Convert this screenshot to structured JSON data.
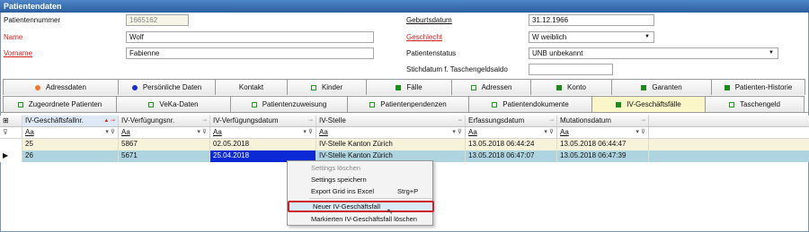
{
  "window": {
    "title": "Patientendaten"
  },
  "form": {
    "patientennummer": {
      "label": "Patientennummer",
      "value": "1665162"
    },
    "name": {
      "label": "Name",
      "value": "Wolf"
    },
    "vorname": {
      "label": "Vorname",
      "value": "Fabienne"
    },
    "geburtsdatum": {
      "label": "Geburtsdatum",
      "value": "31.12.1966"
    },
    "geschlecht": {
      "label": "Geschlecht",
      "value": "W weiblich"
    },
    "patientenstatus": {
      "label": "Patientenstatus",
      "value": "UNB unbekannt"
    },
    "stichdatum": {
      "label": "Stichdatum f. Taschengeldsaldo",
      "value": ""
    }
  },
  "tabs_row1": [
    {
      "label": "Adressdaten",
      "icon": "orange-dot-icon",
      "color": "#f07a2a"
    },
    {
      "label": "Persönliche Daten",
      "icon": "blue-dot-icon",
      "color": "#1530d8"
    },
    {
      "label": "Kontakt",
      "icon": "",
      "color": ""
    },
    {
      "label": "Kinder",
      "icon": "green-square-outline-icon",
      "color": "#1f9a1f"
    },
    {
      "label": "Fälle",
      "icon": "green-square-filled-icon",
      "color": "#1a8c1a"
    },
    {
      "label": "Adressen",
      "icon": "green-square-outline-icon",
      "color": "#1f9a1f"
    },
    {
      "label": "Konto",
      "icon": "green-square-filled-icon",
      "color": "#1a8c1a"
    },
    {
      "label": "Garanten",
      "icon": "green-square-filled-icon",
      "color": "#1a8c1a"
    },
    {
      "label": "Patienten-Historie",
      "icon": "green-square-filled-icon",
      "color": "#1a8c1a"
    }
  ],
  "tabs_row2": [
    {
      "label": "Zugeordnete Patienten",
      "icon": "green-square-outline-icon"
    },
    {
      "label": "VeKa-Daten",
      "icon": "green-square-outline-icon"
    },
    {
      "label": "Patientenzuweisung",
      "icon": "green-square-outline-icon"
    },
    {
      "label": "Patientenpendenzen",
      "icon": "green-square-outline-icon"
    },
    {
      "label": "Patientendokumente",
      "icon": "green-square-outline-icon"
    },
    {
      "label": "IV-Geschäftsfälle",
      "icon": "green-square-filled-icon",
      "active": true
    },
    {
      "label": "Taschengeld",
      "icon": "green-square-outline-icon"
    }
  ],
  "grid": {
    "columns": [
      "IV-Geschäftsfallnr.",
      "IV-Verfügungsnr.",
      "IV-Verfügungsdatum",
      "IV-Stelle",
      "Erfassungsdatum",
      "Mutationsdatum"
    ],
    "filter_placeholder": "Aa",
    "rows": [
      [
        "25",
        "5867",
        "02.05.2018",
        "IV-Stelle Kanton Zürich",
        "13.05.2018 06:44:24",
        "13.05.2018 06:44:47"
      ],
      [
        "26",
        "5671",
        "25.04.2018",
        "IV-Stelle Kanton Zürich",
        "13.05.2018 06:47:07",
        "13.05.2018 06:47:39"
      ]
    ]
  },
  "context_menu": {
    "items": [
      {
        "label": "Settings löschen",
        "disabled": true
      },
      {
        "label": "Settings speichern"
      },
      {
        "label": "Export Grid ins Excel",
        "shortcut": "Strg+P"
      },
      {
        "label": "Neuer IV-Geschäftsfall",
        "highlighted": true
      },
      {
        "label": "Markierten IV-Geschäftsfall löschen"
      }
    ]
  },
  "colors": {
    "title_bar": "#3a6db0",
    "highlight_border": "#d0212b",
    "selected_row": "#aed4e0",
    "selected_cell": "#0b2ad6"
  }
}
